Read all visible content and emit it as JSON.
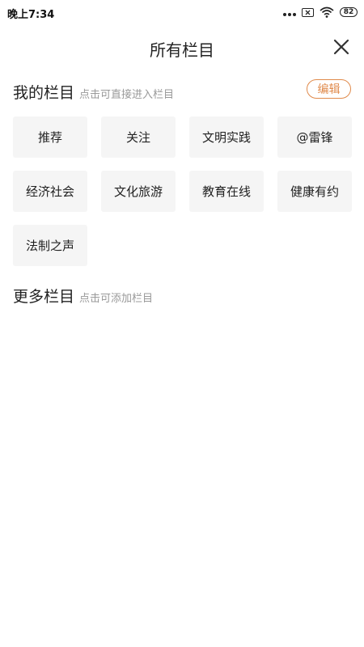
{
  "status_bar": {
    "time": "晚上7:34",
    "battery": "82"
  },
  "header": {
    "title": "所有栏目"
  },
  "my_channels": {
    "title": "我的栏目",
    "hint": "点击可直接进入栏目",
    "edit_label": "编辑",
    "items": [
      "推荐",
      "关注",
      "文明实践",
      "@雷锋",
      "经济社会",
      "文化旅游",
      "教育在线",
      "健康有约",
      "法制之声"
    ]
  },
  "more_channels": {
    "title": "更多栏目",
    "hint": "点击可添加栏目"
  },
  "colors": {
    "accent": "#e08a4b",
    "chip_bg": "#f5f5f5"
  }
}
